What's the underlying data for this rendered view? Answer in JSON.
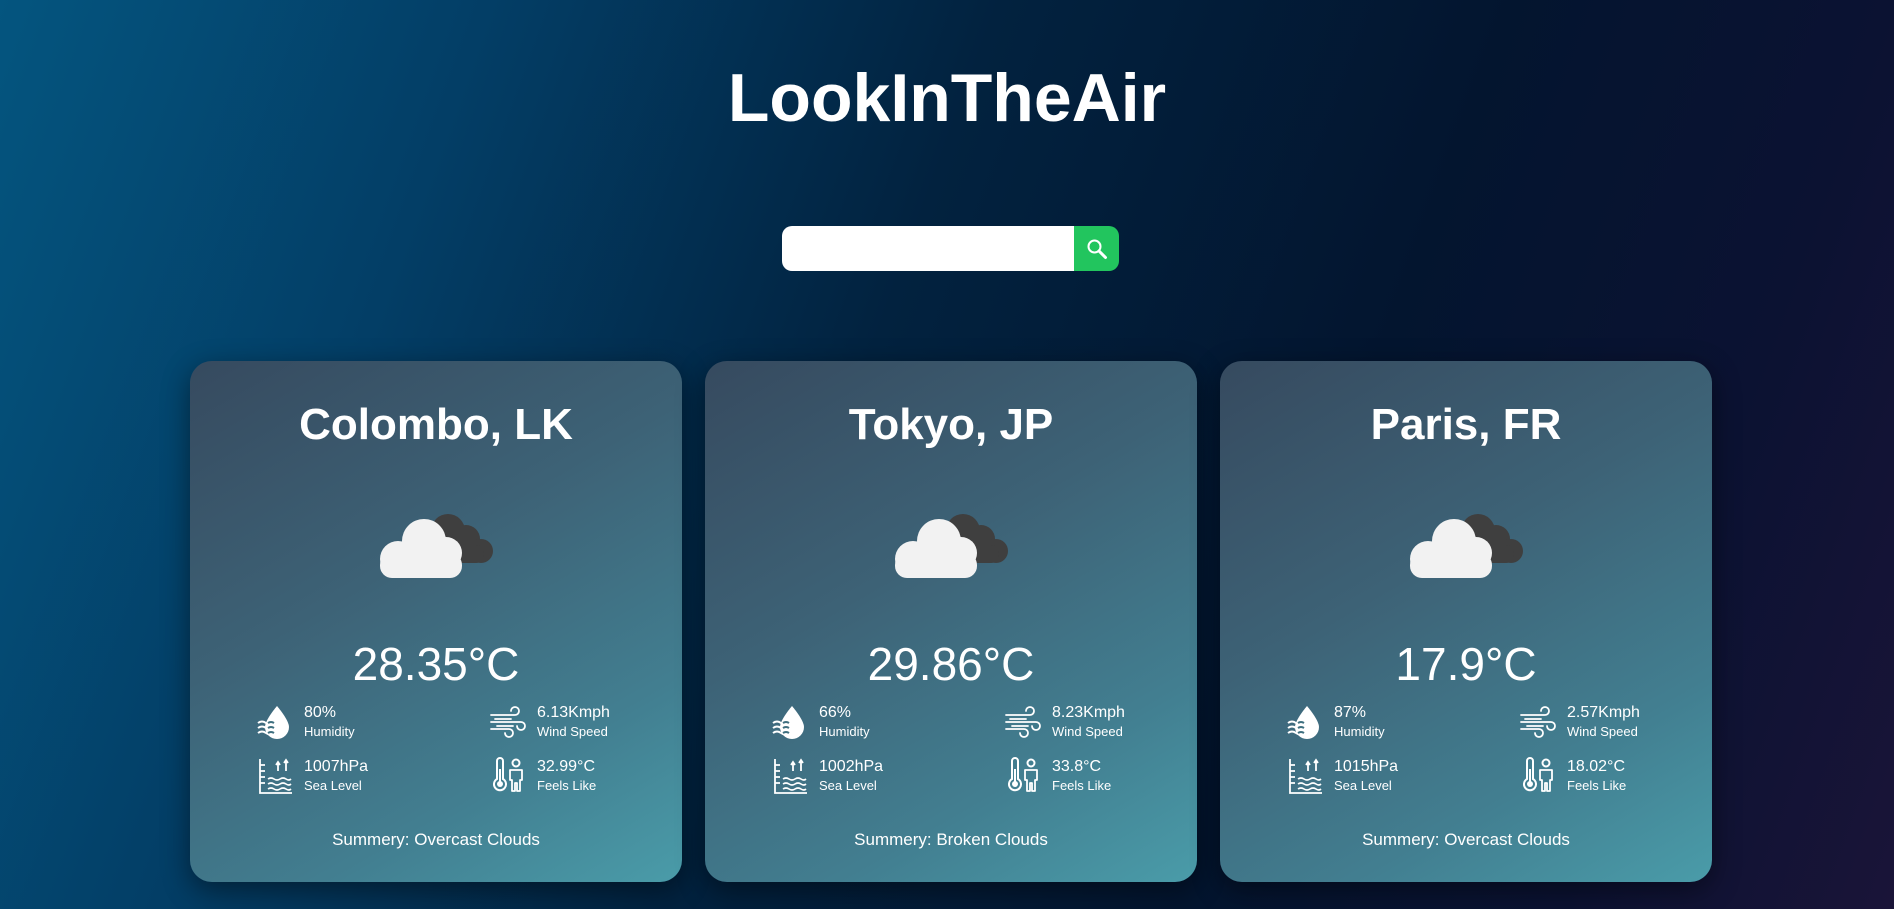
{
  "app": {
    "title": "LookInTheAir"
  },
  "search": {
    "placeholder": "",
    "value": "",
    "button_icon": "search-icon",
    "button_color": "#22c55e"
  },
  "cards": [
    {
      "city": "Colombo, LK",
      "icon": "overcast-clouds-icon",
      "temperature": "28.35°C",
      "humidity": {
        "value": "80%",
        "label": "Humidity"
      },
      "wind": {
        "value": "6.13Kmph",
        "label": "Wind Speed"
      },
      "sea_level": {
        "value": "1007hPa",
        "label": "Sea Level"
      },
      "feels_like": {
        "value": "32.99°C",
        "label": "Feels Like"
      },
      "summary": "Summery: Overcast Clouds"
    },
    {
      "city": "Tokyo, JP",
      "icon": "broken-clouds-icon",
      "temperature": "29.86°C",
      "humidity": {
        "value": "66%",
        "label": "Humidity"
      },
      "wind": {
        "value": "8.23Kmph",
        "label": "Wind Speed"
      },
      "sea_level": {
        "value": "1002hPa",
        "label": "Sea Level"
      },
      "feels_like": {
        "value": "33.8°C",
        "label": "Feels Like"
      },
      "summary": "Summery: Broken Clouds"
    },
    {
      "city": "Paris, FR",
      "icon": "overcast-clouds-icon",
      "temperature": "17.9°C",
      "humidity": {
        "value": "87%",
        "label": "Humidity"
      },
      "wind": {
        "value": "2.57Kmph",
        "label": "Wind Speed"
      },
      "sea_level": {
        "value": "1015hPa",
        "label": "Sea Level"
      },
      "feels_like": {
        "value": "18.02°C",
        "label": "Feels Like"
      },
      "summary": "Summery: Overcast Clouds"
    }
  ]
}
